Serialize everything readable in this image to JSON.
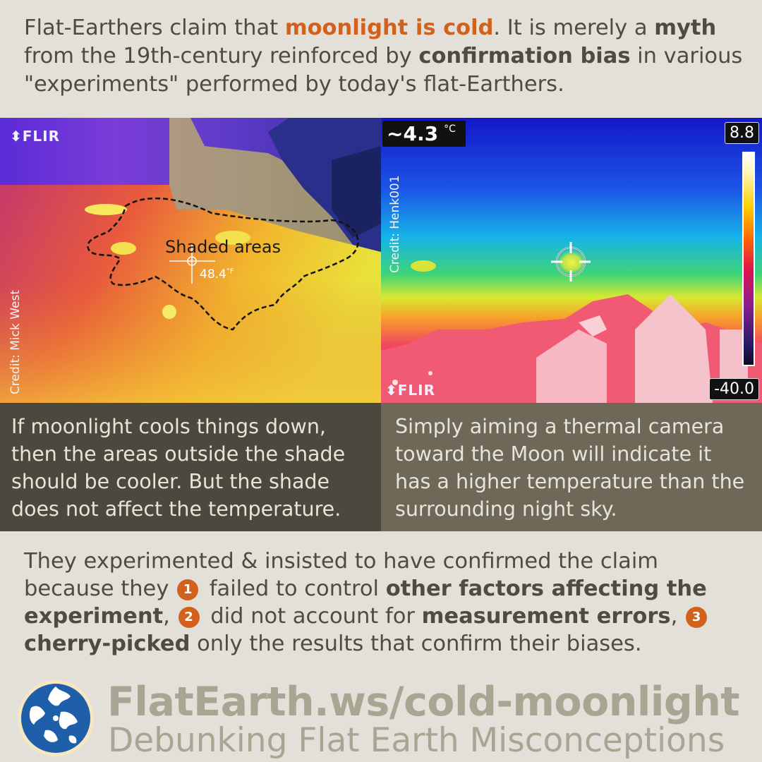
{
  "intro": {
    "p1": "Flat-Earthers claim that ",
    "highlight": "moonlight is cold",
    "p2": ". It is merely a ",
    "bold1": "myth",
    "p3": " from the 19th-century reinforced by ",
    "bold2": "confirmation bias",
    "p4": " in various \"experiments\" performed by today's flat-Earthers."
  },
  "left_panel": {
    "logo": "⬍FLIR",
    "credit": "Credit: Mick West",
    "shaded_label": "Shaded areas",
    "reading_value": "48.4",
    "reading_unit": "°F"
  },
  "right_panel": {
    "logo": "⬍FLIR",
    "credit": "Credit: Henk001",
    "temperature": "~4.3",
    "temperature_unit": "°C",
    "scale_max": "8.8",
    "scale_min": "-40.0"
  },
  "captions": {
    "left": "If moonlight cools things down, then the areas outside the shade should be cooler. But the shade does not affect the temperature.",
    "right": "Simply aiming a thermal camera toward the Moon will indicate it has a higher temperature than the surrounding night sky."
  },
  "conclusion": {
    "c1": "They experimented & insisted to have confirmed the claim because they ",
    "n1": "1",
    "c2": " failed to control ",
    "b1": "other factors affecting the experiment",
    "c3": ", ",
    "n2": "2",
    "c4": " did not account for ",
    "b2": "measurement errors",
    "c5": ", ",
    "n3": "3",
    "c6": " ",
    "b3": "cherry-picked",
    "c7": " only the results that confirm their biases."
  },
  "footer": {
    "url": "FlatEarth.ws/cold-moonlight",
    "tagline": "Debunking Flat Earth Misconceptions"
  },
  "colors": {
    "accent": "#d2611d",
    "background": "#e2e0d9",
    "caption_left_bg": "#4b483d",
    "caption_right_bg": "#6d6857",
    "footer_text": "#aaa593"
  }
}
